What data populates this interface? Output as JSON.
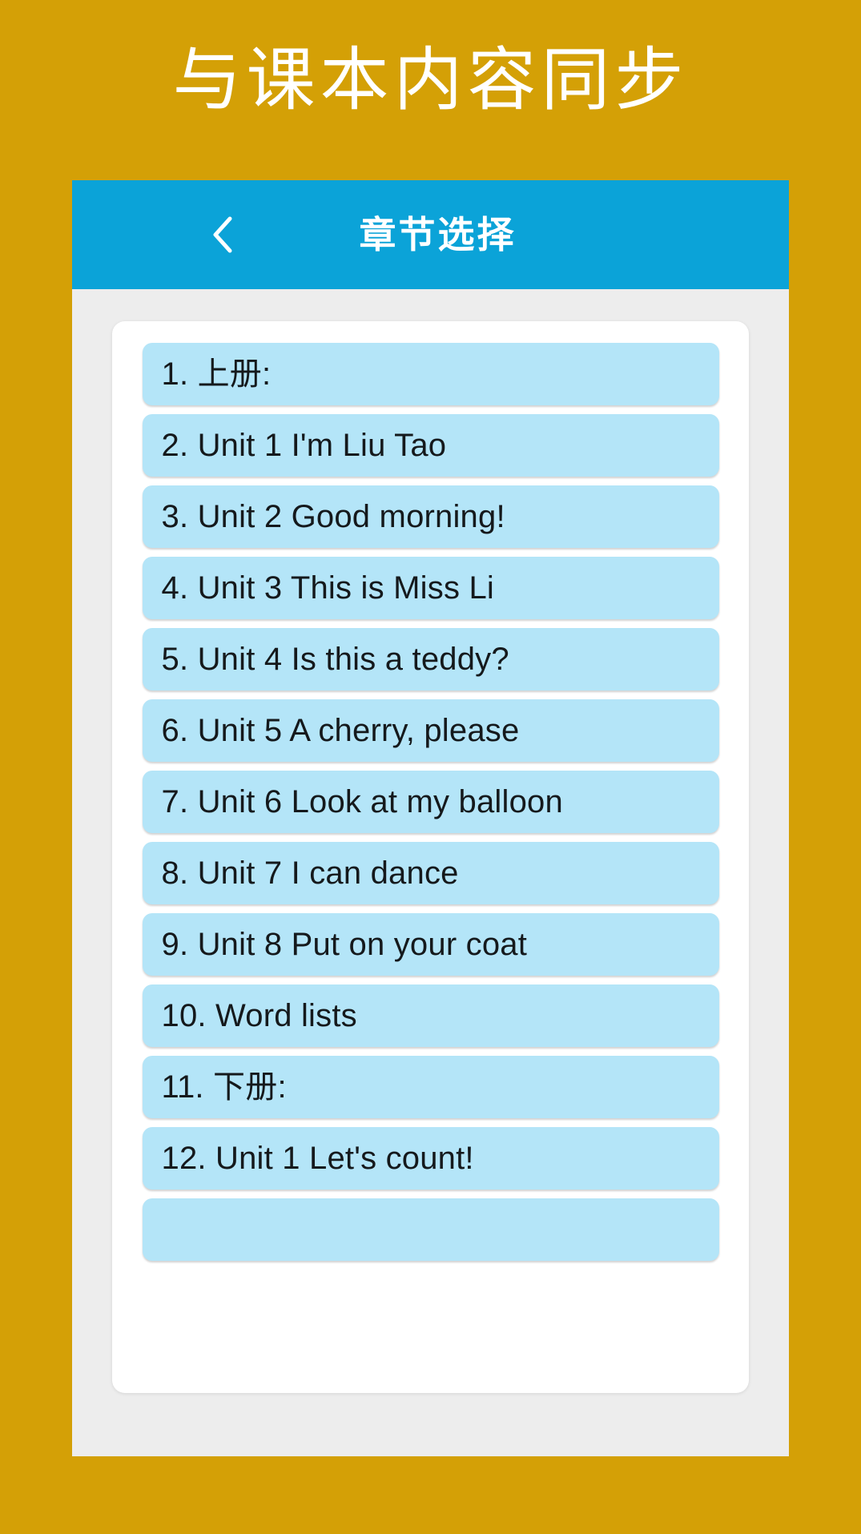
{
  "promo": {
    "headline": "与课本内容同步",
    "background_color": "#D4A006",
    "headline_color": "#FFFFFF"
  },
  "app": {
    "titlebar": {
      "title": "章节选择",
      "back_icon": "chevron-left-icon",
      "background_color": "#0BA3D8",
      "text_color": "#FFFFFF"
    },
    "screen_background": "#EDEDED",
    "card_background": "#FFFFFF",
    "item_background": "#B4E5F8",
    "item_text_color": "#15191C",
    "chapters": [
      {
        "label": "1. 上册:"
      },
      {
        "label": "2. Unit 1 I'm Liu Tao"
      },
      {
        "label": "3. Unit 2 Good morning!"
      },
      {
        "label": "4. Unit 3 This is Miss Li"
      },
      {
        "label": "5. Unit 4 Is this a teddy?"
      },
      {
        "label": "6. Unit 5 A cherry, please"
      },
      {
        "label": "7. Unit 6 Look at my balloon"
      },
      {
        "label": "8. Unit 7 I can dance"
      },
      {
        "label": "9. Unit 8 Put on your coat"
      },
      {
        "label": "10. Word lists"
      },
      {
        "label": "11. 下册:"
      },
      {
        "label": "12. Unit 1 Let's count!"
      },
      {
        "label": ""
      }
    ]
  }
}
